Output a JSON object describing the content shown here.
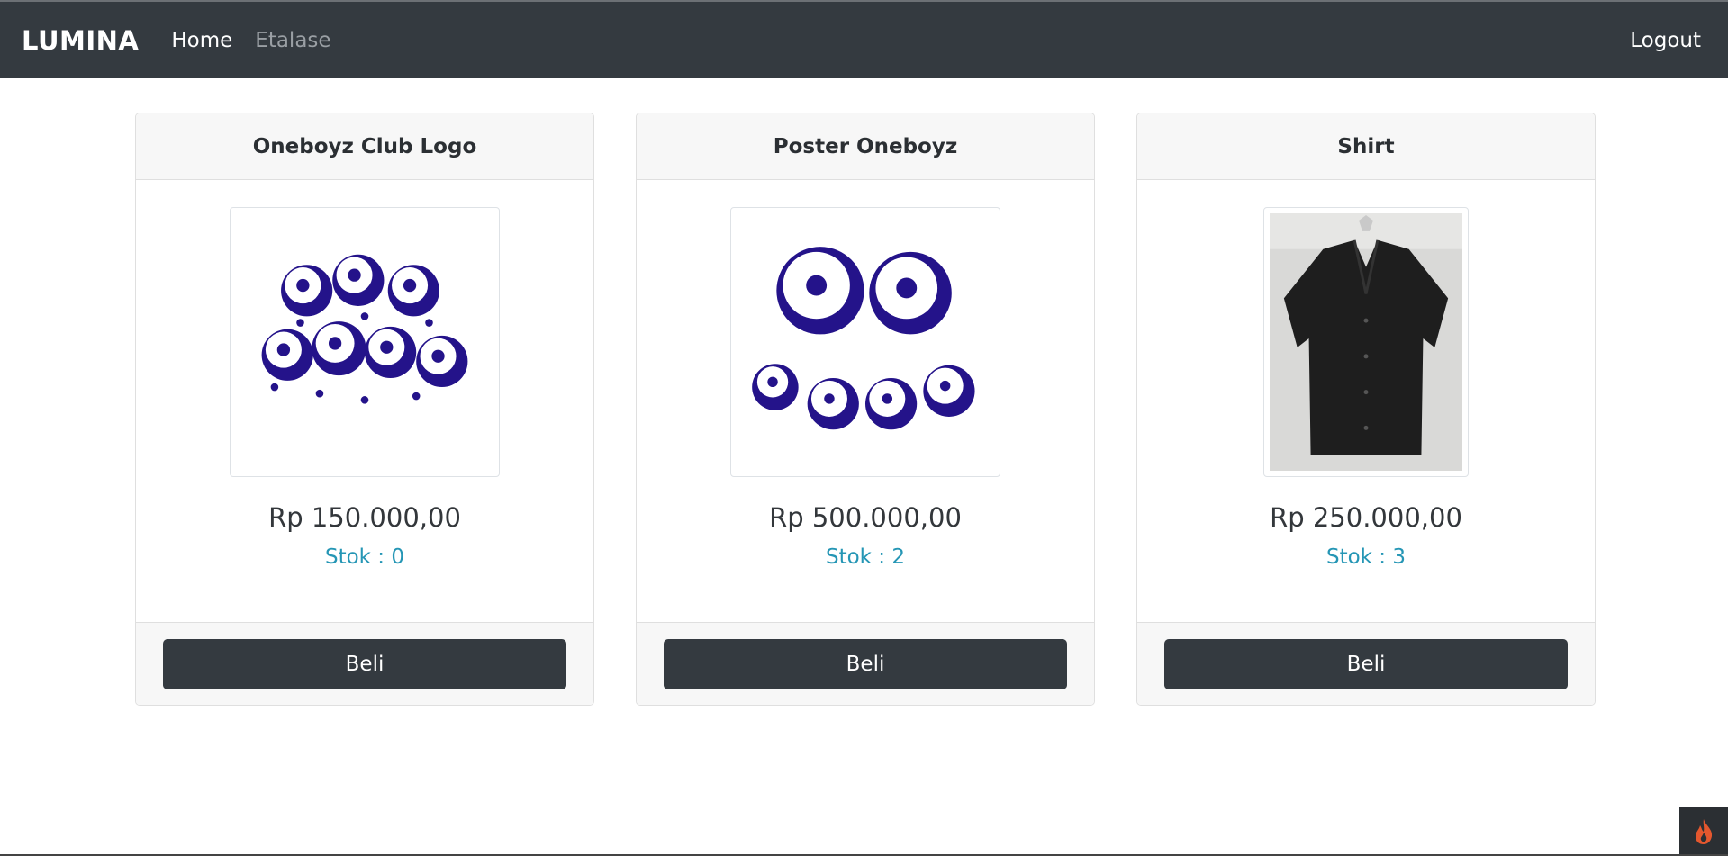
{
  "navbar": {
    "brand": "LUMINA",
    "links": [
      {
        "label": "Home"
      },
      {
        "label": "Etalase"
      }
    ],
    "logout": "Logout"
  },
  "products": [
    {
      "name": "Oneboyz Club Logo",
      "price": "Rp 150.000,00",
      "stock": "Stok : 0",
      "button": "Beli"
    },
    {
      "name": "Poster Oneboyz",
      "price": "Rp 500.000,00",
      "stock": "Stok : 2",
      "button": "Beli"
    },
    {
      "name": "Shirt",
      "price": "Rp 250.000,00",
      "stock": "Stok : 3",
      "button": "Beli"
    }
  ],
  "colors": {
    "navbar": "#343a40",
    "accent_stock": "#2596b5",
    "logo_ink": "#24138a"
  },
  "icons": {
    "corner_widget": "flame-icon"
  }
}
